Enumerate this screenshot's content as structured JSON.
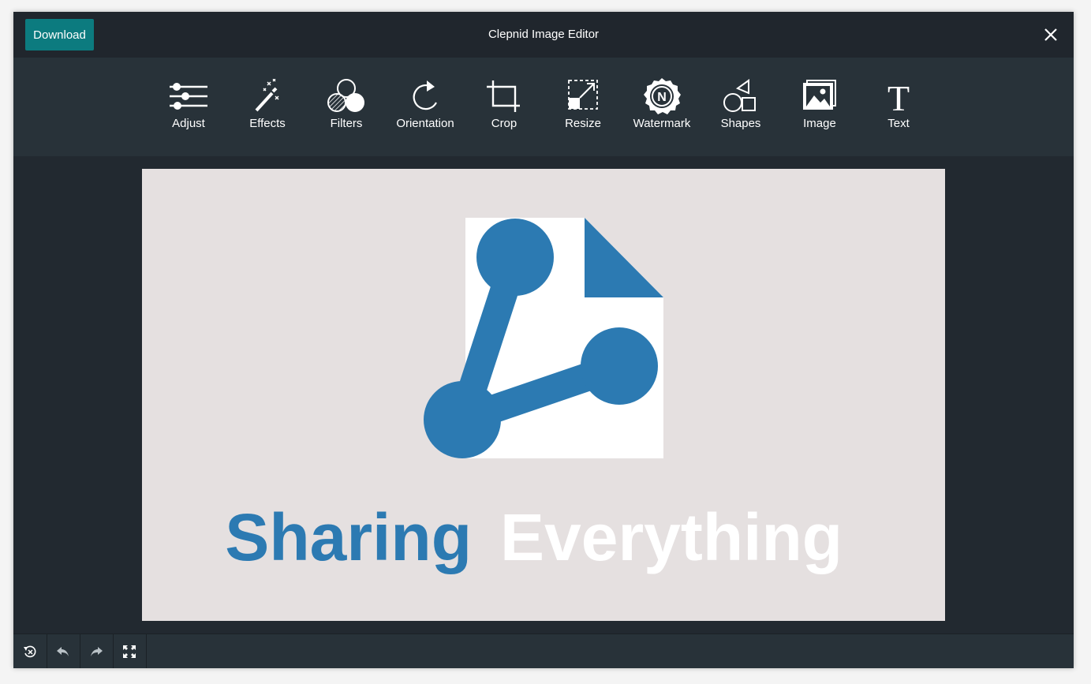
{
  "window": {
    "title": "Clepnid Image Editor",
    "download_label": "Download"
  },
  "colors": {
    "accent": "#0c7b7f",
    "titlebar_bg": "#20262d",
    "toolbar_bg": "#283239",
    "canvas_bg": "#222930",
    "image_bg": "#e5e0e0",
    "logo_blue": "#2c7ab2"
  },
  "toolbar": {
    "tools": [
      {
        "label": "Adjust",
        "icon": "sliders-icon"
      },
      {
        "label": "Effects",
        "icon": "magic-wand-icon"
      },
      {
        "label": "Filters",
        "icon": "filters-icon"
      },
      {
        "label": "Orientation",
        "icon": "rotate-icon"
      },
      {
        "label": "Crop",
        "icon": "crop-icon"
      },
      {
        "label": "Resize",
        "icon": "resize-icon"
      },
      {
        "label": "Watermark",
        "icon": "watermark-icon"
      },
      {
        "label": "Shapes",
        "icon": "shapes-icon"
      },
      {
        "label": "Image",
        "icon": "image-icon"
      },
      {
        "label": "Text",
        "icon": "text-icon"
      }
    ]
  },
  "canvas": {
    "word1": "Sharing",
    "word2": "Everything",
    "watermark_letter": "N",
    "text_tool_glyph": "T"
  },
  "bottombar": {
    "buttons": [
      {
        "name": "reset-button",
        "icon": "reset-icon"
      },
      {
        "name": "undo-button",
        "icon": "undo-icon"
      },
      {
        "name": "redo-button",
        "icon": "redo-icon"
      },
      {
        "name": "fullscreen-button",
        "icon": "fullscreen-icon"
      }
    ]
  }
}
